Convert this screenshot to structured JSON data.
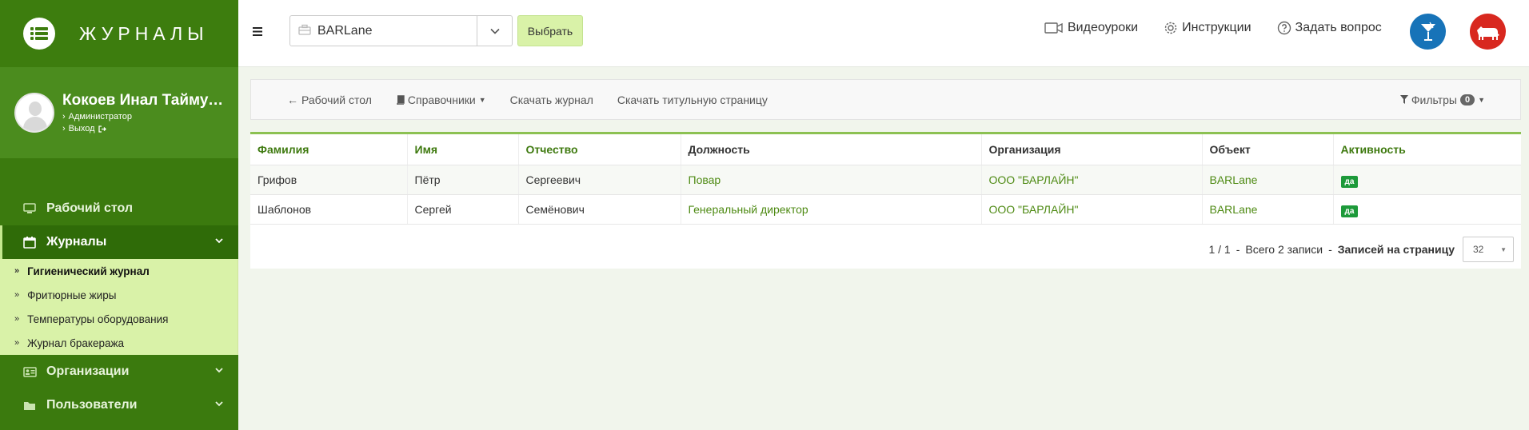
{
  "app": {
    "title": "ЖУРНАЛЫ"
  },
  "profile": {
    "name": "Кокоев Инал Таймураз",
    "role": "Администратор",
    "logout": "Выход"
  },
  "sidebar": {
    "items": [
      {
        "label": "Рабочий стол",
        "icon": "monitor-icon"
      },
      {
        "label": "Журналы",
        "icon": "calendar-icon",
        "active": true
      },
      {
        "label": "Организации",
        "icon": "id-card-icon"
      },
      {
        "label": "Пользователи",
        "icon": "folder-icon"
      }
    ],
    "journals": [
      {
        "label": "Гигиенический журнал",
        "active": true
      },
      {
        "label": "Фритюрные жиры"
      },
      {
        "label": "Температуры оборудования"
      },
      {
        "label": "Журнал бракеража"
      }
    ]
  },
  "topbar": {
    "object_select_value": "BARLane",
    "choose_button": "Выбрать",
    "video_lessons": "Видеоуроки",
    "instructions": "Инструкции",
    "ask_question": "Задать вопрос"
  },
  "nav": {
    "desktop": "Рабочий стол",
    "references": "Справочники",
    "download_journal": "Скачать журнал",
    "download_title_page": "Скачать титульную страницу",
    "filters": "Фильтры",
    "filters_count": "0"
  },
  "table": {
    "headers": [
      "Фамилия",
      "Имя",
      "Отчество",
      "Должность",
      "Организация",
      "Объект",
      "Активность"
    ],
    "rows": [
      {
        "last": "Грифов",
        "first": "Пётр",
        "middle": "Сергеевич",
        "position": "Повар",
        "org": "ООО \"БАРЛАЙН\"",
        "object": "BARLane",
        "active": "да"
      },
      {
        "last": "Шаблонов",
        "first": "Сергей",
        "middle": "Семёнович",
        "position": "Генеральный директор",
        "org": "ООО \"БАРЛАЙН\"",
        "object": "BARLane",
        "active": "да"
      }
    ]
  },
  "pager": {
    "pages": "1 / 1",
    "sep": "-",
    "total": "Всего 2 записи",
    "per_page_label": "Записей на страницу",
    "per_page_value": "32"
  },
  "colors": {
    "sidebar": "#3b7a0e",
    "submenu": "#d9f2a8",
    "accent_link": "#4e8a13",
    "badge_yes": "#1d9a3a",
    "cocktail_button": "#1773b8",
    "cow_button": "#d8281f"
  }
}
